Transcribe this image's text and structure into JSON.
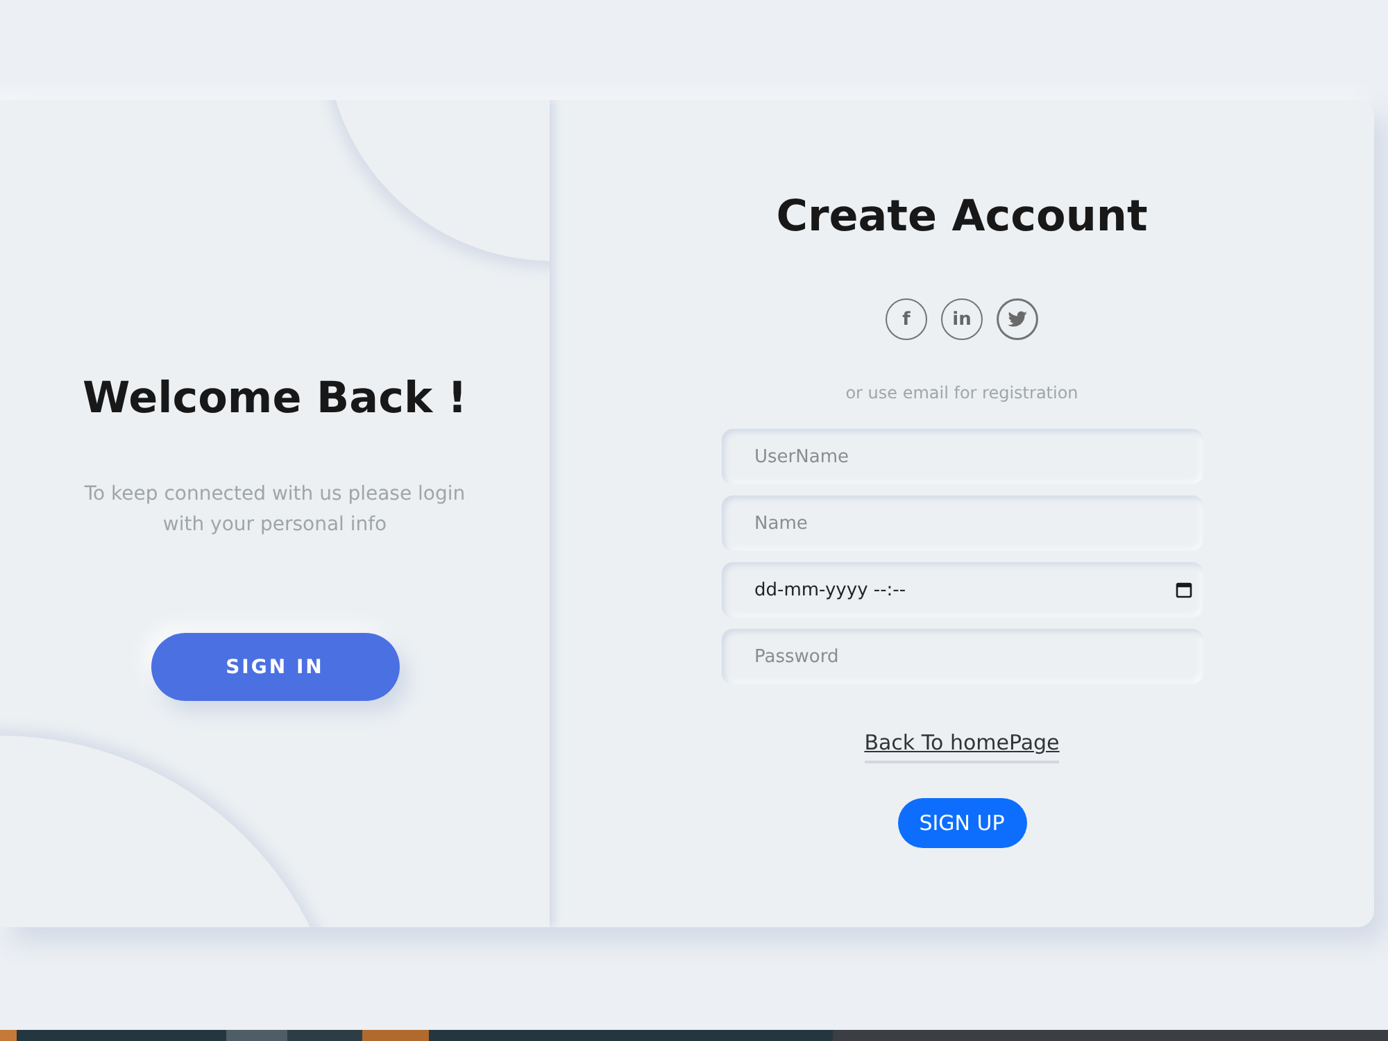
{
  "welcome_panel": {
    "title": "Welcome Back !",
    "description": "To keep connected with us please login with your personal info",
    "button": "SIGN IN"
  },
  "signup_panel": {
    "title": "Create Account",
    "social_buttons": [
      {
        "kind": "letter",
        "label": "f"
      },
      {
        "kind": "letter",
        "label": "in"
      },
      {
        "kind": "bird"
      }
    ],
    "hint": "or use email for registration",
    "fields": [
      {
        "kind": "text",
        "placeholder": "UserName"
      },
      {
        "kind": "text",
        "placeholder": "Name"
      },
      {
        "kind": "datetime",
        "placeholder": "dd-mm-yyyy --:--"
      },
      {
        "kind": "password",
        "placeholder": "Password"
      }
    ],
    "link": "Back To homePage",
    "button": "SIGN UP"
  }
}
